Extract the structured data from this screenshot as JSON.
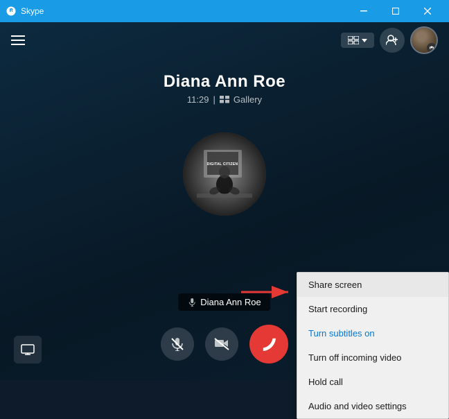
{
  "titleBar": {
    "icon": "S",
    "title": "Skype",
    "minimize": "—",
    "maximize": "❐",
    "close": "✕"
  },
  "topBar": {
    "layoutLabel": "□⌄",
    "addPersonLabel": "👤+",
    "avatarAlt": "user avatar"
  },
  "callInfo": {
    "callerName": "Diana Ann Roe",
    "callTime": "11:29",
    "separator": "|",
    "galleryIcon": "🖼",
    "galleryLabel": "Gallery"
  },
  "nameLabel": {
    "micIcon": "🎤",
    "name": "Diana Ann Roe"
  },
  "controls": {
    "screenShareTitle": "⬜",
    "muteLabel": "🎙",
    "videoOffLabel": "🎥",
    "endCallLabel": "📞"
  },
  "contextMenu": {
    "items": [
      {
        "id": "share-screen",
        "label": "Share screen",
        "highlighted": true,
        "blue": false
      },
      {
        "id": "start-recording",
        "label": "Start recording",
        "highlighted": false,
        "blue": false
      },
      {
        "id": "turn-subtitles-on",
        "label": "Turn subtitles on",
        "highlighted": false,
        "blue": true
      },
      {
        "id": "turn-off-incoming-video",
        "label": "Turn off incoming video",
        "highlighted": false,
        "blue": false
      },
      {
        "id": "hold-call",
        "label": "Hold call",
        "highlighted": false,
        "blue": false
      },
      {
        "id": "audio-video-settings",
        "label": "Audio and video settings",
        "highlighted": false,
        "blue": false
      }
    ]
  },
  "dcText": "DIGITAL CITIZEN"
}
